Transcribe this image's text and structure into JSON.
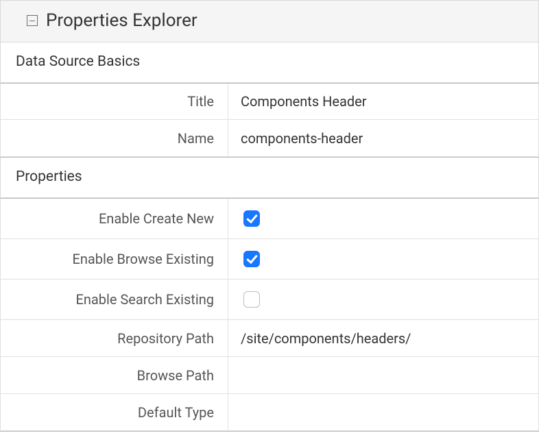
{
  "panel": {
    "title": "Properties Explorer"
  },
  "sections": {
    "basics": {
      "heading": "Data Source Basics",
      "rows": {
        "title": {
          "label": "Title",
          "value": "Components Header"
        },
        "name": {
          "label": "Name",
          "value": "components-header"
        }
      }
    },
    "properties": {
      "heading": "Properties",
      "rows": {
        "enable_create_new": {
          "label": "Enable Create New",
          "checked": true
        },
        "enable_browse_existing": {
          "label": "Enable Browse Existing",
          "checked": true
        },
        "enable_search_existing": {
          "label": "Enable Search Existing",
          "checked": false
        },
        "repository_path": {
          "label": "Repository Path",
          "value": "/site/components/headers/"
        },
        "browse_path": {
          "label": "Browse Path",
          "value": ""
        },
        "default_type": {
          "label": "Default Type",
          "value": ""
        }
      }
    }
  }
}
